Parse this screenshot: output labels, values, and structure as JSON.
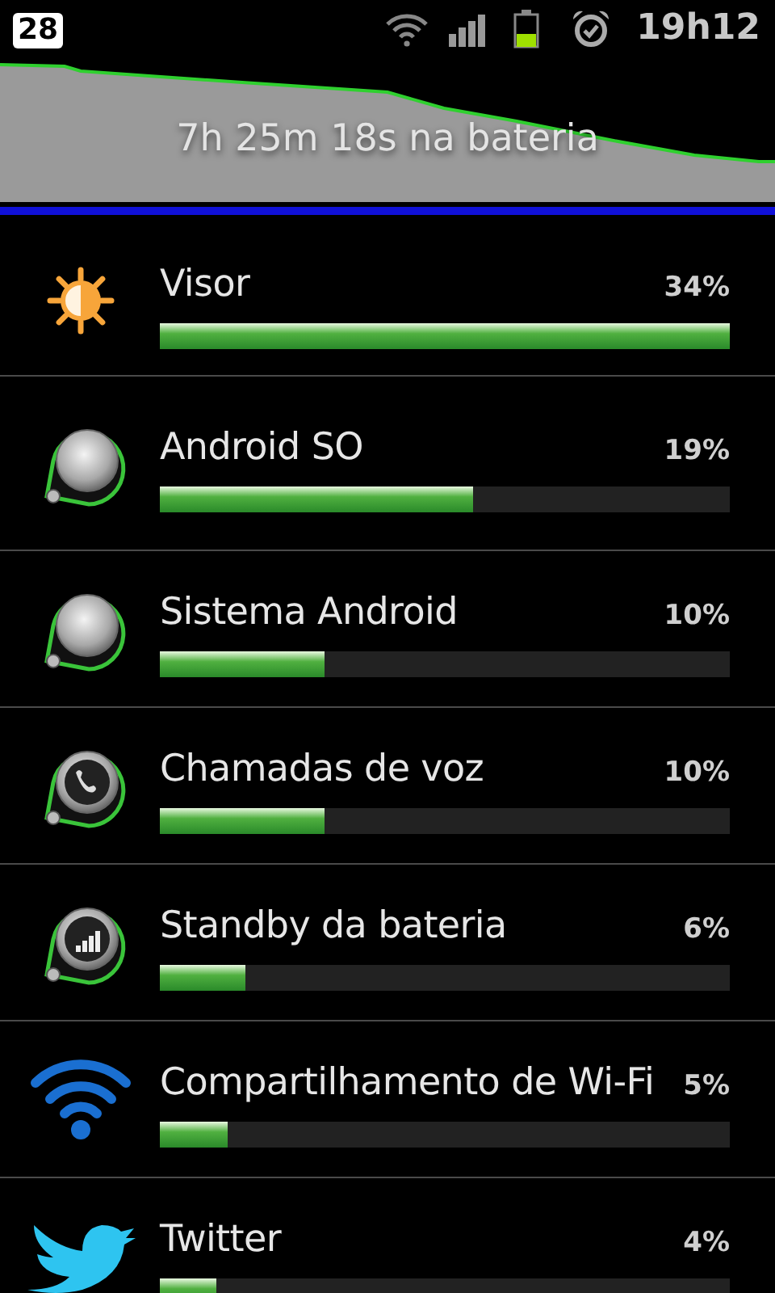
{
  "status_bar": {
    "notification_count": "28",
    "time": "19h12"
  },
  "battery_graph": {
    "caption": "7h 25m 18s na bateria"
  },
  "usage": [
    {
      "kind": "display",
      "name": "Visor",
      "percent": "34%",
      "level": 1.0
    },
    {
      "kind": "system",
      "name": "Android SO",
      "percent": "19%",
      "level": 0.55
    },
    {
      "kind": "system",
      "name": "Sistema Android",
      "percent": "10%",
      "level": 0.29
    },
    {
      "kind": "phone",
      "name": "Chamadas de voz",
      "percent": "10%",
      "level": 0.29
    },
    {
      "kind": "signal",
      "name": "Standby da bateria",
      "percent": "6%",
      "level": 0.15
    },
    {
      "kind": "wifi",
      "name": "Compartilhamento de Wi-Fi",
      "percent": "5%",
      "level": 0.12
    },
    {
      "kind": "bird",
      "name": "Twitter",
      "percent": "4%",
      "level": 0.1
    }
  ]
}
